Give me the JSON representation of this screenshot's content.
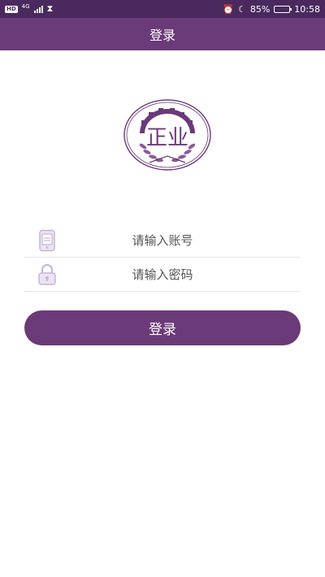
{
  "status_bar": {
    "hd": "HD",
    "network": "4G",
    "battery_text": "85%",
    "battery_level": 0.85,
    "time": "10:58",
    "icons": [
      "signal-icon",
      "hourglass-icon",
      "alarm-icon",
      "moon-icon",
      "battery-icon"
    ]
  },
  "header": {
    "title": "登录"
  },
  "logo": {
    "text": "正业",
    "icon": "gear-laurel-emblem"
  },
  "form": {
    "account": {
      "placeholder": "请输入账号",
      "value": "",
      "icon": "phone-icon"
    },
    "password": {
      "placeholder": "请输入密码",
      "value": "",
      "icon": "lock-icon"
    }
  },
  "login_button": {
    "label": "登录"
  },
  "colors": {
    "primary": "#6b3a78",
    "status_bar": "#4a2a5e",
    "icon_light": "#c7b3d6"
  }
}
